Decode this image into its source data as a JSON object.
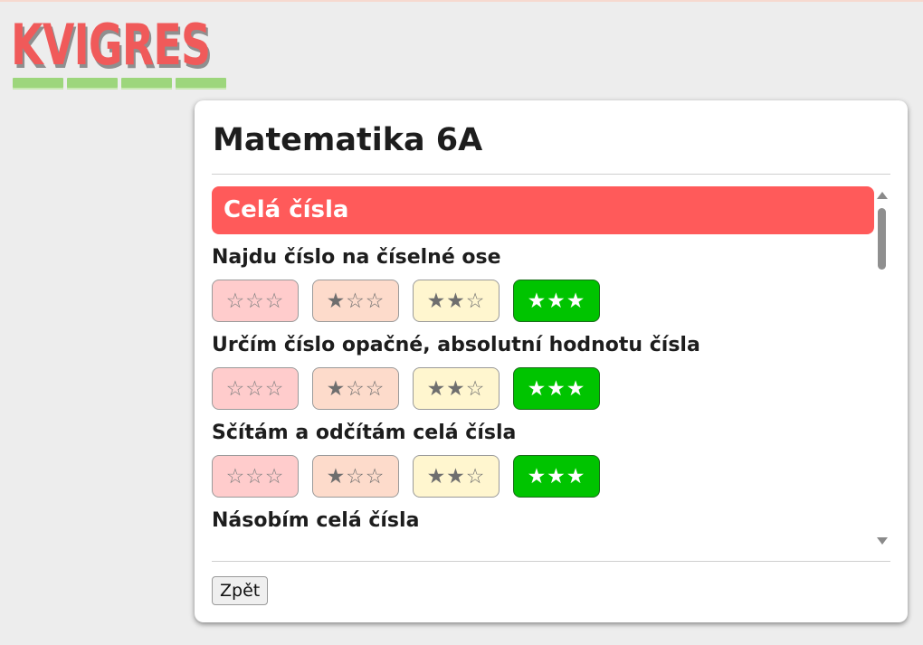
{
  "logo": {
    "text": "KVIGRES",
    "bar_segments": 4
  },
  "card": {
    "title": "Matematika 6A",
    "section_title": "Celá čísla",
    "skills": [
      {
        "title": "Najdu číslo na číselné ose",
        "selected_level": 3
      },
      {
        "title": "Určím číslo opačné, absolutní hodnotu čísla",
        "selected_level": 3
      },
      {
        "title": "Sčítám a odčítám celá čísla",
        "selected_level": 3
      },
      {
        "title": "Násobím celá čísla",
        "selected_level": null
      }
    ],
    "levels": [
      "☆☆☆",
      "★☆☆",
      "★★☆",
      "★★★"
    ],
    "back_label": "Zpět"
  },
  "colors": {
    "section_header": "#ff5a5a",
    "level_0": "#ffcccc",
    "level_1": "#fddbcb",
    "level_2": "#fff6cf",
    "level_3_selected": "#00c400"
  }
}
